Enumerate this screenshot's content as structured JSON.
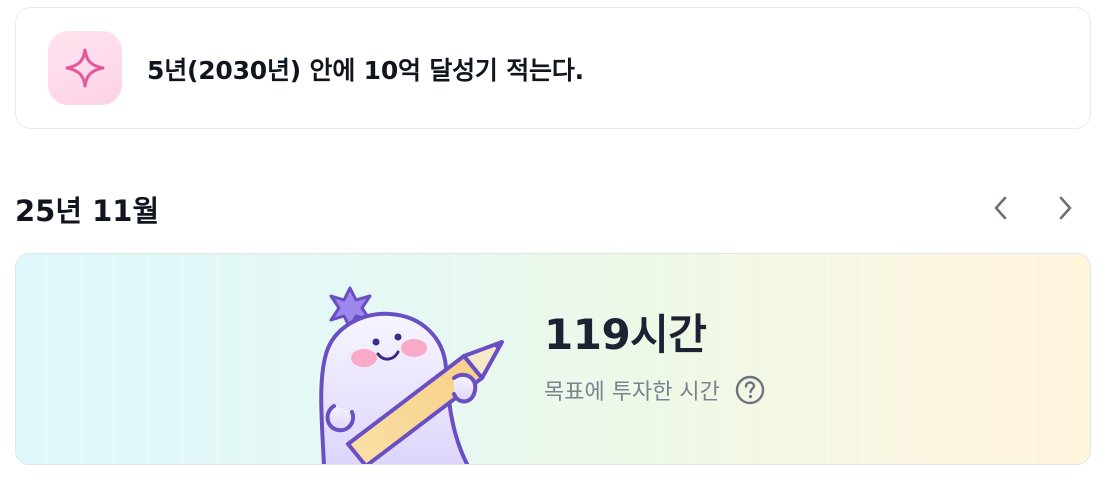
{
  "goal": {
    "icon": "sparkle-icon",
    "text": "5년(2030년) 안에 10억 달성기 적는다."
  },
  "month": {
    "title": "25년 11월",
    "prev_icon": "chevron-left-icon",
    "next_icon": "chevron-right-icon"
  },
  "stats": {
    "value": "119시간",
    "caption": "목표에 투자한 시간",
    "help_icon": "question-circle-icon",
    "illustration": "mascot-with-pencil"
  },
  "colors": {
    "accent_purple": "#6a4fc4",
    "icon_pink": "#e85c9b",
    "text_dark": "#111520",
    "text_muted": "#7d828e"
  }
}
